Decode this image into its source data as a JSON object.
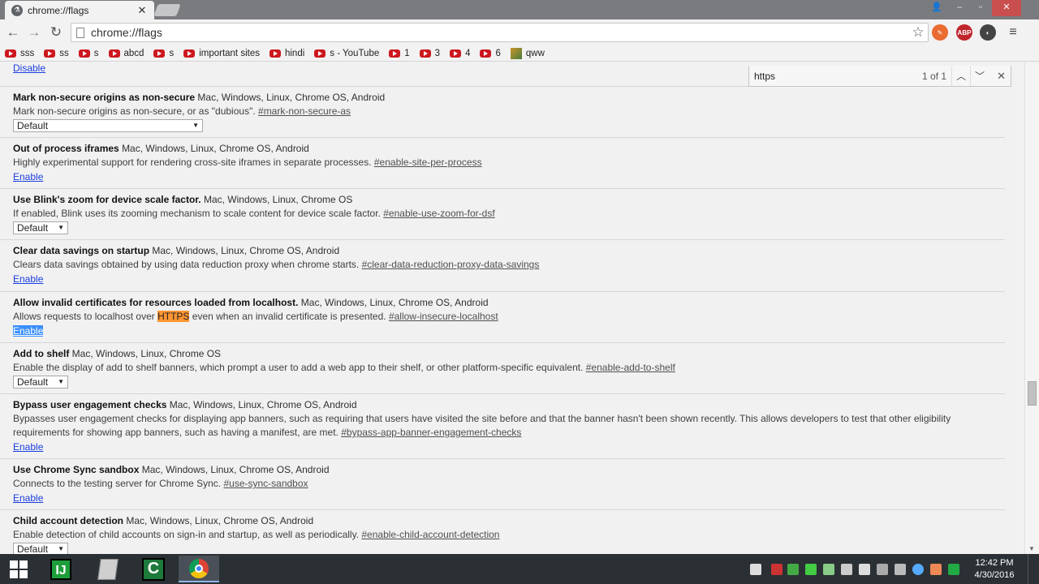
{
  "browser": {
    "tab_title": "chrome://flags",
    "url": "chrome://flags",
    "window_controls": {
      "close": "✕"
    }
  },
  "bookmarks": [
    {
      "label": "sss",
      "icon": "youtube-icon"
    },
    {
      "label": "ss",
      "icon": "youtube-icon"
    },
    {
      "label": "s",
      "icon": "youtube-icon"
    },
    {
      "label": "abcd",
      "icon": "youtube-icon"
    },
    {
      "label": "s",
      "icon": "youtube-icon"
    },
    {
      "label": "important sites",
      "icon": "youtube-icon"
    },
    {
      "label": "hindi",
      "icon": "youtube-icon"
    },
    {
      "label": "s - YouTube",
      "icon": "youtube-icon"
    },
    {
      "label": "1",
      "icon": "youtube-icon"
    },
    {
      "label": "3",
      "icon": "youtube-icon"
    },
    {
      "label": "4",
      "icon": "youtube-icon"
    },
    {
      "label": "6",
      "icon": "youtube-icon"
    },
    {
      "label": "qww",
      "icon": "image-icon"
    }
  ],
  "extensions": {
    "abp": "ABP"
  },
  "findbar": {
    "query": "https",
    "count": "1 of 1"
  },
  "top_link": "Disable",
  "flags": [
    {
      "name": "Mark non-secure origins as non-secure",
      "platforms": "Mac, Windows, Linux, Chrome OS, Android",
      "desc": "Mark non-secure origins as non-secure, or as \"dubious\".",
      "anchor": "#mark-non-secure-as",
      "control": "select",
      "control_label": "Default"
    },
    {
      "name": "Out of process iframes",
      "platforms": "Mac, Windows, Linux, Chrome OS, Android",
      "desc": "Highly experimental support for rendering cross-site iframes in separate processes.",
      "anchor": "#enable-site-per-process",
      "control": "link",
      "control_label": "Enable"
    },
    {
      "name": "Use Blink's zoom for device scale factor.",
      "platforms": "Mac, Windows, Linux, Chrome OS",
      "desc": "If enabled, Blink uses its zooming mechanism to scale content for device scale factor.",
      "anchor": "#enable-use-zoom-for-dsf",
      "control": "select",
      "control_label": "Default"
    },
    {
      "name": "Clear data savings on startup",
      "platforms": "Mac, Windows, Linux, Chrome OS, Android",
      "desc": "Clears data savings obtained by using data reduction proxy when chrome starts.",
      "anchor": "#clear-data-reduction-proxy-data-savings",
      "control": "link",
      "control_label": "Enable"
    },
    {
      "name": "Allow invalid certificates for resources loaded from localhost.",
      "platforms": "Mac, Windows, Linux, Chrome OS, Android",
      "desc_before": "Allows requests to localhost over",
      "desc_highlight": "HTTPS",
      "desc_after": "even when an invalid certificate is presented.",
      "anchor": "#allow-insecure-localhost",
      "control": "link",
      "control_label": "Enable"
    },
    {
      "name": "Add to shelf",
      "platforms": "Mac, Windows, Linux, Chrome OS",
      "desc": "Enable the display of add to shelf banners, which prompt a user to add a web app to their shelf, or other platform-specific equivalent.",
      "anchor": "#enable-add-to-shelf",
      "control": "select",
      "control_label": "Default"
    },
    {
      "name": "Bypass user engagement checks",
      "platforms": "Mac, Windows, Linux, Chrome OS, Android",
      "desc": "Bypasses user engagement checks for displaying app banners, such as requiring that users have visited the site before and that the banner hasn't been shown recently. This allows developers to test that other eligibility requirements for showing app banners, such as having a manifest, are met.",
      "anchor": "#bypass-app-banner-engagement-checks",
      "control": "link",
      "control_label": "Enable"
    },
    {
      "name": "Use Chrome Sync sandbox",
      "platforms": "Mac, Windows, Linux, Chrome OS, Android",
      "desc": "Connects to the testing server for Chrome Sync.",
      "anchor": "#use-sync-sandbox",
      "control": "link",
      "control_label": "Enable"
    },
    {
      "name": "Child account detection",
      "platforms": "Mac, Windows, Linux, Chrome OS, Android",
      "desc": "Enable detection of child accounts on sign-in and startup, as well as periodically.",
      "anchor": "#enable-child-account-detection",
      "control": "select",
      "control_label": "Default"
    }
  ],
  "taskbar": {
    "apps": [
      "windows-start-icon",
      "intellij-icon",
      "notepad-icon",
      "camtasia-icon",
      "chrome-icon"
    ],
    "intellij_letter": "IJ",
    "camtasia_letter": "C",
    "clock_time": "12:42 PM",
    "clock_date": "4/30/2016"
  },
  "colors": {
    "find_highlight": "#ff9632",
    "selection": "#3a8fff",
    "link": "#1a3ee0"
  }
}
